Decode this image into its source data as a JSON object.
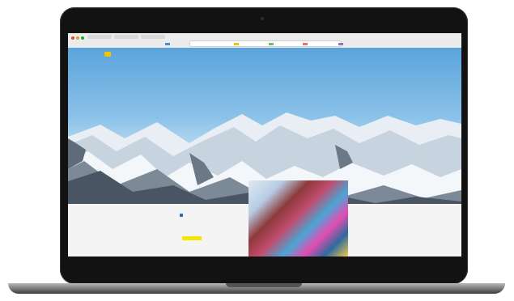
{
  "browser": {
    "url": "",
    "dot_colors": [
      "#e0443e",
      "#dea123",
      "#1aab29"
    ],
    "bookmark_colors": [
      "#4a90d9",
      "#f4c400",
      "#6fbf73",
      "#e07a5f",
      "#8e7cc3"
    ]
  },
  "site": {
    "logo": "",
    "accent": "#f4c400",
    "nav": [
      "",
      "",
      ""
    ],
    "headline": "",
    "subline": "",
    "promo_title": "",
    "promo_desc": "",
    "promo_cta": "",
    "footer_note": ""
  }
}
